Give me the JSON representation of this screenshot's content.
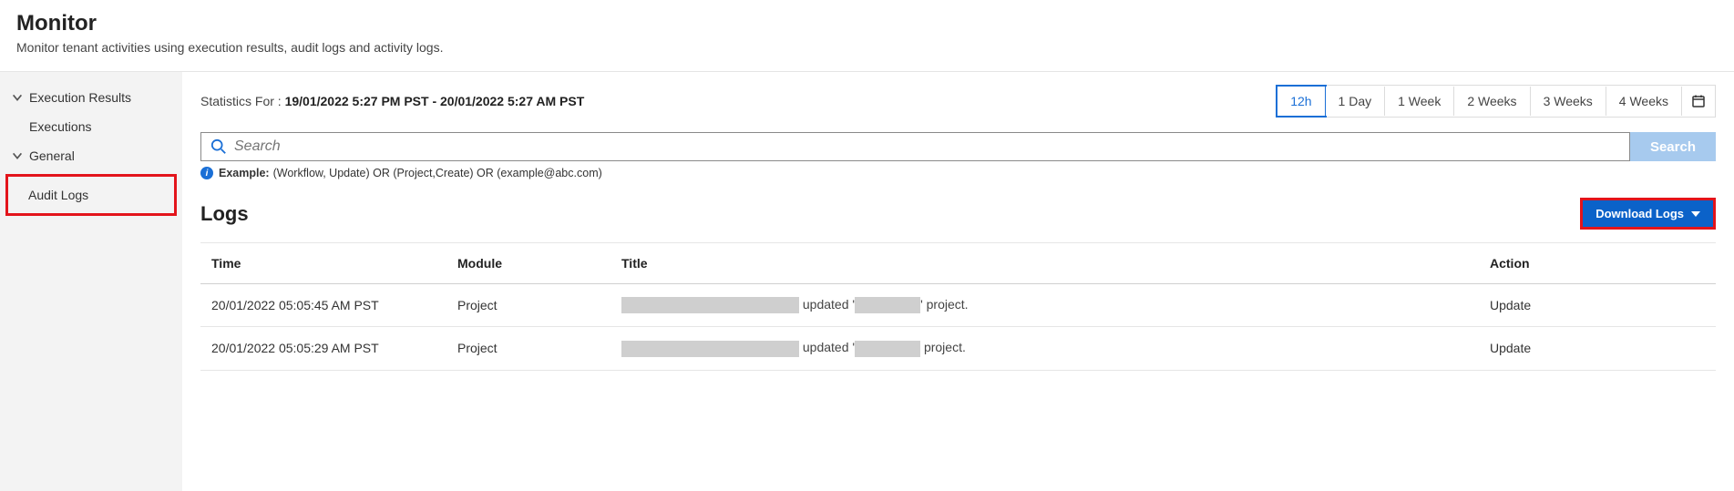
{
  "header": {
    "title": "Monitor",
    "subtitle": "Monitor tenant activities using execution results, audit logs and activity logs."
  },
  "sidebar": {
    "groups": [
      {
        "label": "Execution Results",
        "items": [
          {
            "label": "Executions"
          }
        ]
      },
      {
        "label": "General",
        "items": [
          {
            "label": "Audit Logs"
          }
        ]
      }
    ]
  },
  "stats": {
    "prefix": "Statistics For : ",
    "range": "19/01/2022 5:27 PM PST - 20/01/2022 5:27 AM PST"
  },
  "range_buttons": [
    "12h",
    "1 Day",
    "1 Week",
    "2 Weeks",
    "3 Weeks",
    "4 Weeks"
  ],
  "range_active_index": 0,
  "search": {
    "placeholder": "Search",
    "button_label": "Search",
    "example_label": "Example:",
    "example_text": "(Workflow, Update) OR (Project,Create) OR (example@abc.com)"
  },
  "logs": {
    "heading": "Logs",
    "download_label": "Download Logs",
    "columns": {
      "time": "Time",
      "module": "Module",
      "title": "Title",
      "action": "Action"
    },
    "rows": [
      {
        "time": "20/01/2022 05:05:45 AM PST",
        "module": "Project",
        "title_mid": " updated '",
        "title_end": "' project.",
        "action": "Update"
      },
      {
        "time": "20/01/2022 05:05:29 AM PST",
        "module": "Project",
        "title_mid": " updated '",
        "title_end": " project.",
        "action": "Update"
      }
    ]
  }
}
